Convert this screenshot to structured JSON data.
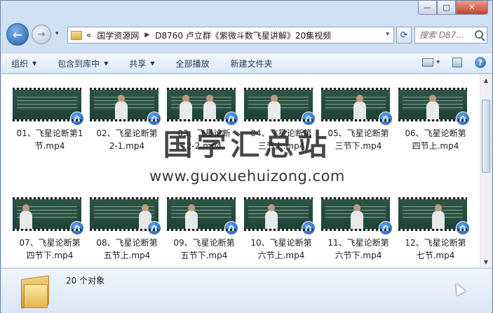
{
  "window": {
    "caption_buttons": [
      {
        "name": "minimize",
        "glyph": "—"
      },
      {
        "name": "maximize",
        "glyph": "□"
      },
      {
        "name": "close",
        "glyph": "✕"
      }
    ]
  },
  "nav": {
    "back_glyph": "←",
    "forward_glyph": "→",
    "history_glyph": "▾",
    "refresh_glyph": "⟳",
    "address": {
      "prefix": "«",
      "crumbs": [
        "国学资源网",
        "D8760 卢立群《紫微斗数飞星讲解》20集视频"
      ],
      "separator": "▶",
      "dropdown_glyph": "▾"
    },
    "search": {
      "placeholder": "搜索 D87..."
    }
  },
  "toolbar": {
    "items": [
      {
        "label": "组织",
        "dropdown": true
      },
      {
        "label": "包含到库中",
        "dropdown": true
      },
      {
        "label": "共享",
        "dropdown": true
      },
      {
        "label": "全部播放",
        "dropdown": false
      },
      {
        "label": "新建文件夹",
        "dropdown": false
      }
    ],
    "view_dropdown_glyph": "▾",
    "help_glyph": "?"
  },
  "files": [
    {
      "line1": "01、飞星论断第1",
      "line2": "节.mp4"
    },
    {
      "line1": "02、飞星论断第",
      "line2": "2-1.mp4"
    },
    {
      "line1": "03、飞星论断",
      "line2": "2-2.mp4"
    },
    {
      "line1": "04、飞星论断第",
      "line2": "三节上.mp4"
    },
    {
      "line1": "05、飞星论断第",
      "line2": "三节下.mp4"
    },
    {
      "line1": "06、飞星论断第",
      "line2": "四节上.mp4"
    },
    {
      "line1": "07、飞星论断第",
      "line2": "四节下.mp4"
    },
    {
      "line1": "08、飞星论断第",
      "line2": "五节上.mp4"
    },
    {
      "line1": "09、飞星论断第",
      "line2": "五节下.mp4"
    },
    {
      "line1": "10、飞星论断第",
      "line2": "六节上.mp4"
    },
    {
      "line1": "11、飞星论断第",
      "line2": "六节下.mp4"
    },
    {
      "line1": "12、飞星论断第",
      "line2": "七节.mp4"
    }
  ],
  "watermark": {
    "title": "国学汇总站",
    "url": "www.guoxuehuizong.com"
  },
  "scrollbar": {
    "up_glyph": "▲",
    "down_glyph": "▼"
  },
  "details": {
    "item_count": "20 个对象"
  },
  "colors": {
    "accent": "#1d5fb1",
    "chrome": "#cfe0f3",
    "toolbar_text": "#1e395b",
    "board_green": "#2d5546"
  }
}
